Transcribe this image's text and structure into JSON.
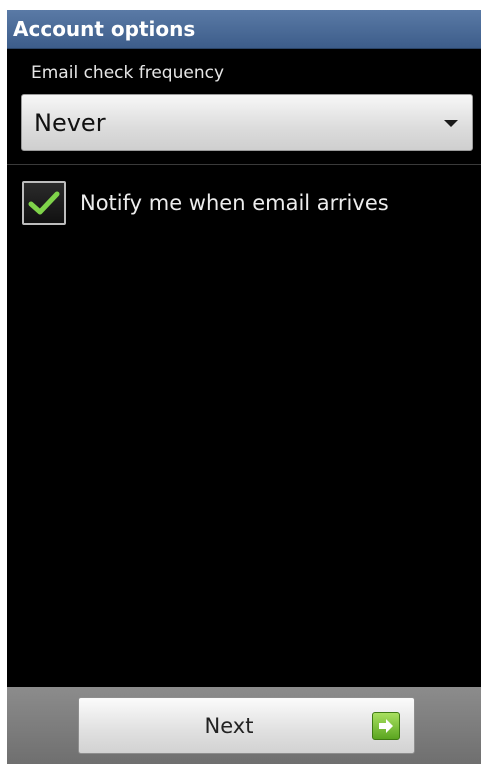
{
  "header": {
    "title": "Account options"
  },
  "frequency": {
    "label": "Email check frequency",
    "selected": "Never",
    "arrow_icon": "dropdown-arrow-icon"
  },
  "notify": {
    "checked": true,
    "label": "Notify me when email arrives",
    "check_icon": "checkmark-icon"
  },
  "footer": {
    "next_label": "Next",
    "next_icon": "arrow-right-icon"
  },
  "colors": {
    "titlebar": "#4a6a97",
    "background": "#000000",
    "check_accent": "#7fd34a",
    "next_icon": "#7ac63a"
  }
}
